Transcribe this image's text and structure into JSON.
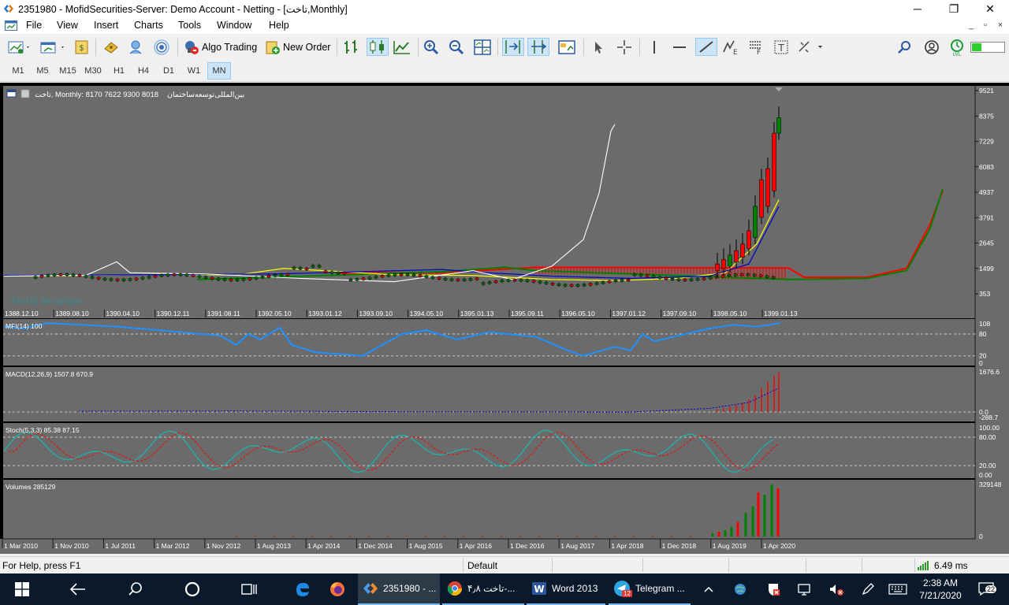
{
  "window": {
    "title": "2351980 - MofidSecurities-Server: Demo Account - Netting - [تاخت,Monthly]",
    "minimize_glyph": "─",
    "restore_glyph": "❐",
    "close_glyph": "✕"
  },
  "menu": {
    "items": [
      "File",
      "View",
      "Insert",
      "Charts",
      "Tools",
      "Window",
      "Help"
    ],
    "child_min": "_",
    "child_restore": "▫",
    "child_close": "×"
  },
  "toolbar": {
    "algo_trading": "Algo Trading",
    "new_order": "New Order"
  },
  "timeframes": {
    "items": [
      "M1",
      "M5",
      "M15",
      "M30",
      "H1",
      "H4",
      "D1",
      "W1",
      "MN"
    ],
    "selected": "MN"
  },
  "chart": {
    "header": "تاخت, Monthly:  8170 7622 9300 8018",
    "header_rtl_name": "بین‌المللی‌توسعه‌ساختمان",
    "watermark": "Mofid Securities",
    "price_axis": [
      "9521",
      "8375",
      "7229",
      "6083",
      "4937",
      "3791",
      "2645",
      "1499",
      "353"
    ],
    "date_axis": [
      "1388.12.10",
      "1389.08.10",
      "1390.04.10",
      "1390.12.11",
      "1391.08.11",
      "1392.05.10",
      "1393.01.12",
      "1393.09.10",
      "1394.05.10",
      "1395.01.13",
      "1395.09.11",
      "1396.05.10",
      "1397.01.12",
      "1397.09.10",
      "1398.05.10",
      "1399.01.13"
    ],
    "bottom_axis": [
      "1 Mar 2010",
      "1 Nov 2010",
      "1 Jul 2011",
      "1 Mar 2012",
      "1 Nov 2012",
      "1 Aug 2013",
      "1 Apr 2014",
      "1 Dec 2014",
      "1 Aug 2015",
      "1 Apr 2016",
      "1 Dec 2016",
      "1 Aug 2017",
      "1 Apr 2018",
      "1 Dec 2018",
      "1 Aug 2019",
      "1 Apr 2020"
    ]
  },
  "panels": {
    "mfi": {
      "label": "MFI(14) 100",
      "axis": [
        "108",
        "80",
        "20",
        "0"
      ]
    },
    "macd": {
      "label": "MACD(12,26,9) 1507.8 670.9",
      "axis": [
        "1676.6",
        "0.0",
        "-288.7"
      ]
    },
    "stoch": {
      "label": "Stoch(5,3,3) 85.38 87.15",
      "axis": [
        "100.00",
        "80.00",
        "20.00",
        "0.00"
      ]
    },
    "volume": {
      "label": "Volumes 285129",
      "axis": [
        "329148",
        "0"
      ]
    }
  },
  "colors": {
    "chart_bg": "#6b6b6b",
    "bull": "#008000",
    "bear": "#ff0000",
    "ma_yellow": "#ffff00",
    "ma_blue": "#0000c8",
    "white_line": "#ffffff",
    "mfi_line": "#1e90ff",
    "stoch_main": "#20b2aa",
    "stoch_signal": "#ff0000"
  },
  "status": {
    "help": "For Help, press F1",
    "profile": "Default",
    "connection": "6.49 ms"
  },
  "taskbar": {
    "apps": [
      {
        "label": "2351980 - ...",
        "icon": "mt5-icon",
        "active": true
      },
      {
        "label": "تاخت ۴٫۸-...",
        "icon": "chrome-icon",
        "active": false
      },
      {
        "label": "Word 2013",
        "icon": "word-icon",
        "active": false
      },
      {
        "label": "Telegram ...",
        "icon": "telegram-icon",
        "active": false
      }
    ],
    "telegram_badge": "12",
    "time": "2:38 AM",
    "date": "7/21/2020",
    "notification_count": "22"
  }
}
